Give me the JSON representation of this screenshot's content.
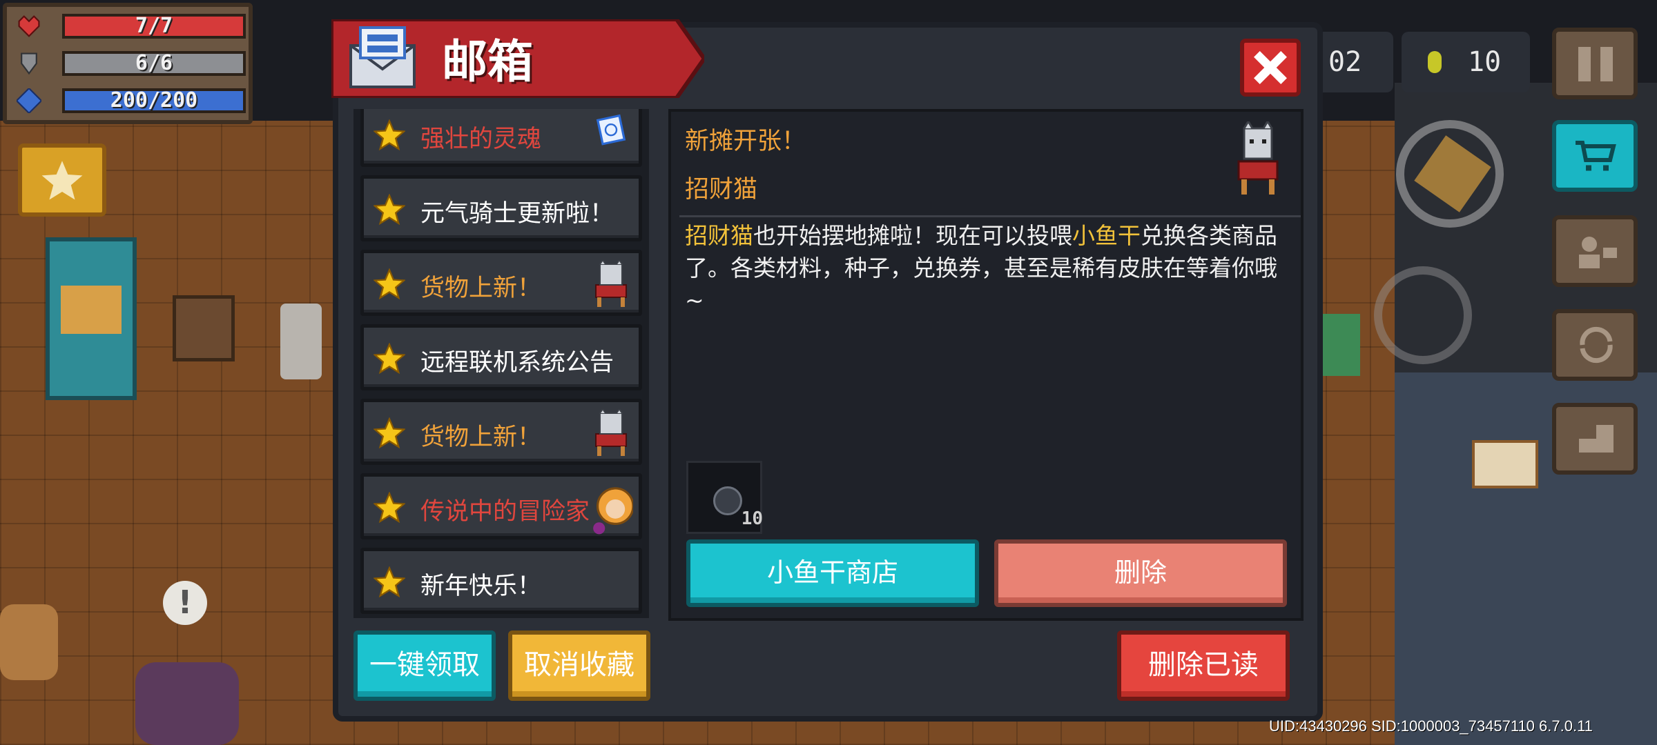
{
  "hud": {
    "hp": "7/7",
    "armor": "6/6",
    "energy": "200/200",
    "gems": "02",
    "coins": "10",
    "hp_color": "#d63a3a",
    "armor_color": "#8d8f93",
    "energy_color": "#3c6fd1"
  },
  "dialog": {
    "title": "邮箱",
    "close_icon": "close-icon"
  },
  "mail_list": [
    {
      "label": "强壮的灵魂",
      "color": "#e0463e",
      "thumb": "scroll"
    },
    {
      "label": "元气骑士更新啦！",
      "color": "#ffffff",
      "thumb": ""
    },
    {
      "label": "货物上新！",
      "color": "#f0a23a",
      "thumb": "cat"
    },
    {
      "label": "远程联机系统公告",
      "color": "#ffffff",
      "thumb": ""
    },
    {
      "label": "货物上新！",
      "color": "#f0a23a",
      "thumb": "cat"
    },
    {
      "label": "传说中的冒险家",
      "color": "#e0463e",
      "thumb": "adventurer"
    },
    {
      "label": "新年快乐！",
      "color": "#ffffff",
      "thumb": ""
    }
  ],
  "detail": {
    "sender": "新摊开张！",
    "subject": "招财猫",
    "body_hl1": "招财猫",
    "body_part1": "也开始摆地摊啦！现在可以投喂",
    "body_hl2": "小鱼干",
    "body_part2": "兑换各类商品了。各类材料，种子，兑换券，甚至是稀有皮肤在等着你哦~",
    "attachment_count": "10"
  },
  "buttons": {
    "shop": "小鱼干商店",
    "delete": "删除",
    "claim_all": "一键领取",
    "unfavorite": "取消收藏",
    "delete_read": "删除已读"
  },
  "footer": {
    "uid": "UID:43430296 SID:1000003_73457110 6.7.0.11"
  }
}
